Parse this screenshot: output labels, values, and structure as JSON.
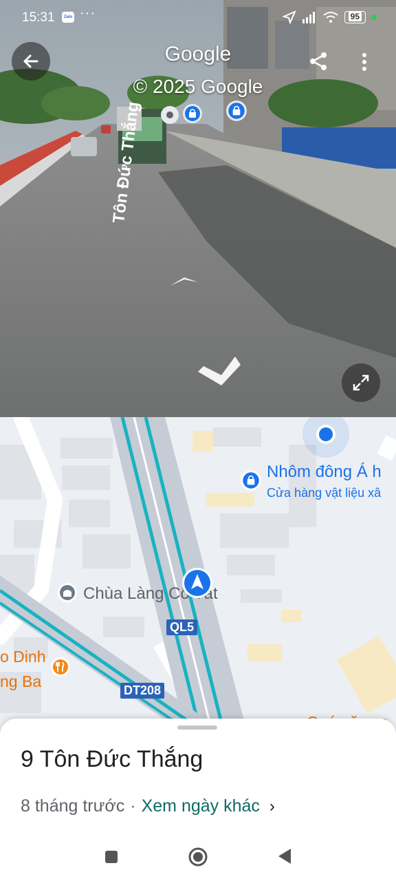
{
  "status_bar": {
    "time": "15:31",
    "zalo": "Zalo",
    "more": "···",
    "battery": "95"
  },
  "street_view": {
    "title": "Google",
    "subtitle": "© 2025 Google",
    "street_label": "Tôn Đức Thắng"
  },
  "map": {
    "poi_title": "Nhôm đông Á h",
    "poi_subtitle": "Cửa hàng vật liệu xâ",
    "temple": "Chùa Làng Cổ Tắt",
    "road_ql": "QL5",
    "road_dt": "DT208",
    "restaurant_line1": "o Dinh",
    "restaurant_line2": "ng Ba",
    "bottom_right_label": "Quán ăn sa"
  },
  "sheet": {
    "address": "9 Tôn Đức Thắng",
    "age": "8 tháng trước",
    "separator": "·",
    "link": "Xem ngày khác",
    "chevron": "›"
  },
  "colors": {
    "accent_blue": "#1a73e8",
    "road_teal": "#19b2c1",
    "link_green": "#0f6b63",
    "shield_blue": "#2d62b7"
  },
  "icons": [
    "back-arrow-icon",
    "share-icon",
    "more-vert-icon",
    "expand-icon",
    "shopping-bag-icon",
    "temple-icon",
    "restaurant-icon",
    "navigation-arrow-icon",
    "location-dot-icon"
  ]
}
